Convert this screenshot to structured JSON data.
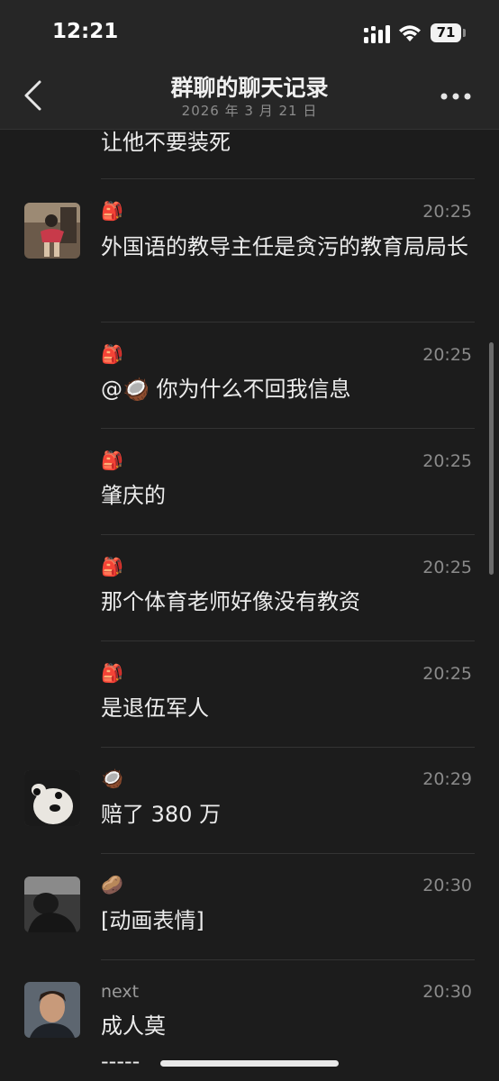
{
  "status": {
    "time": "12:21",
    "battery": "71"
  },
  "nav": {
    "title": "群聊的聊天记录",
    "subtitle": "2026 年 3 月 21 日"
  },
  "icons": {
    "backpack": "🎒",
    "coconut": "🥥",
    "potato": "🥔"
  },
  "messages": [
    {
      "text": "让他不要装死"
    },
    {
      "sender_icon": "🎒",
      "time": "20:25",
      "text": "外国语的教导主任是贪污的教育局局长"
    },
    {
      "sender_icon": "🎒",
      "time": "20:25",
      "text_prefix": "@",
      "mention_icon": "🥥",
      "text": " 你为什么不回我信息"
    },
    {
      "sender_icon": "🎒",
      "time": "20:25",
      "text": "肇庆的"
    },
    {
      "sender_icon": "🎒",
      "time": "20:25",
      "text": "那个体育老师好像没有教资"
    },
    {
      "sender_icon": "🎒",
      "time": "20:25",
      "text": "是退伍军人"
    },
    {
      "sender_icon": "🥥",
      "time": "20:29",
      "text": "赔了 380 万"
    },
    {
      "sender_icon": "🥔",
      "time": "20:30",
      "text": "[动画表情]"
    },
    {
      "sender": "next",
      "time": "20:30",
      "text": "成人莫",
      "text2": "-----"
    }
  ]
}
